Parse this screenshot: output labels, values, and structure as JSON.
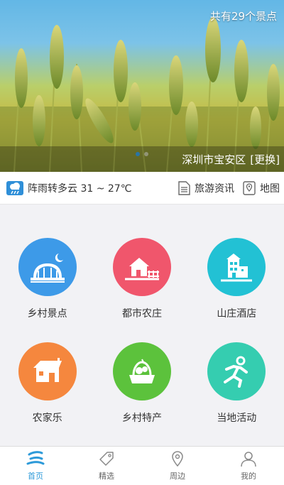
{
  "banner": {
    "count_text": "共有29个景点",
    "location": "深圳市宝安区",
    "change_label": "[更换]"
  },
  "info": {
    "weather": "阵雨转多云 31 ~ 27℃",
    "travel_news": "旅游资讯",
    "map": "地图"
  },
  "categories": [
    {
      "label": "乡村景点",
      "color": "#3d9ae8",
      "icon": "bridge-moon-icon"
    },
    {
      "label": "都市农庄",
      "color": "#f0566c",
      "icon": "farmhouse-icon"
    },
    {
      "label": "山庄酒店",
      "color": "#22c1d4",
      "icon": "hotel-icon"
    },
    {
      "label": "农家乐",
      "color": "#f5873e",
      "icon": "cottage-icon"
    },
    {
      "label": "乡村特产",
      "color": "#5cc23c",
      "icon": "basket-icon"
    },
    {
      "label": "当地活动",
      "color": "#35cdb0",
      "icon": "running-person-icon"
    }
  ],
  "tabs": [
    {
      "label": "首页",
      "active": true
    },
    {
      "label": "精选",
      "active": false
    },
    {
      "label": "周边",
      "active": false
    },
    {
      "label": "我的",
      "active": false
    }
  ],
  "colors": {
    "accent": "#2d9ad9"
  }
}
